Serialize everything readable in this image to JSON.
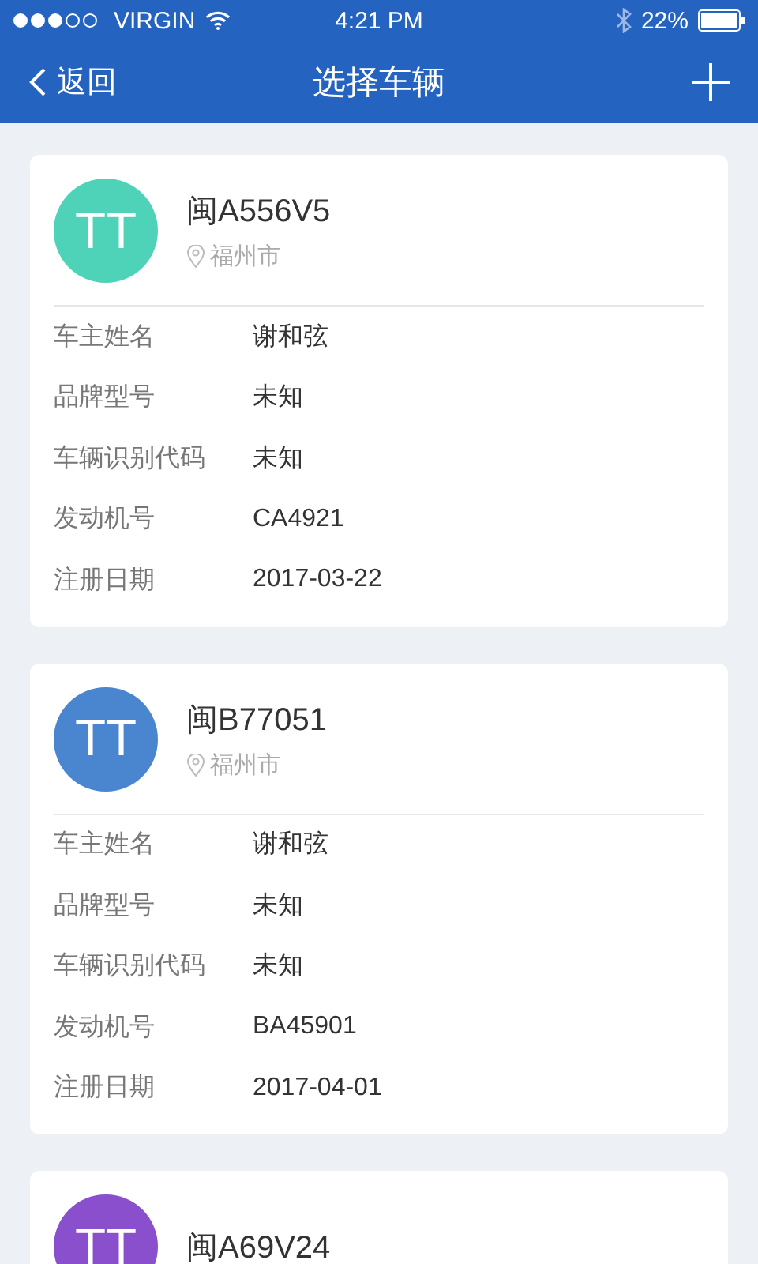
{
  "status_bar": {
    "carrier": "VIRGIN",
    "time": "4:21 PM",
    "battery": "22%"
  },
  "nav": {
    "back": "返回",
    "title": "选择车辆"
  },
  "vehicles": [
    {
      "avatar": "TT",
      "color": "#4ed3b8",
      "plate": "闽A556V5",
      "city": "福州市",
      "fields": [
        {
          "label": "车主姓名",
          "value": "谢和弦"
        },
        {
          "label": "品牌型号",
          "value": "未知"
        },
        {
          "label": "车辆识别代码",
          "value": "未知"
        },
        {
          "label": "发动机号",
          "value": "CA4921"
        },
        {
          "label": "注册日期",
          "value": "2017-03-22"
        }
      ]
    },
    {
      "avatar": "TT",
      "color": "#4a86d0",
      "plate": "闽B77051",
      "city": "福州市",
      "fields": [
        {
          "label": "车主姓名",
          "value": "谢和弦"
        },
        {
          "label": "品牌型号",
          "value": "未知"
        },
        {
          "label": "车辆识别代码",
          "value": "未知"
        },
        {
          "label": "发动机号",
          "value": "BA45901"
        },
        {
          "label": "注册日期",
          "value": "2017-04-01"
        }
      ]
    },
    {
      "avatar": "TT",
      "color": "#8a4fcc",
      "plate": "闽A69V24"
    }
  ]
}
